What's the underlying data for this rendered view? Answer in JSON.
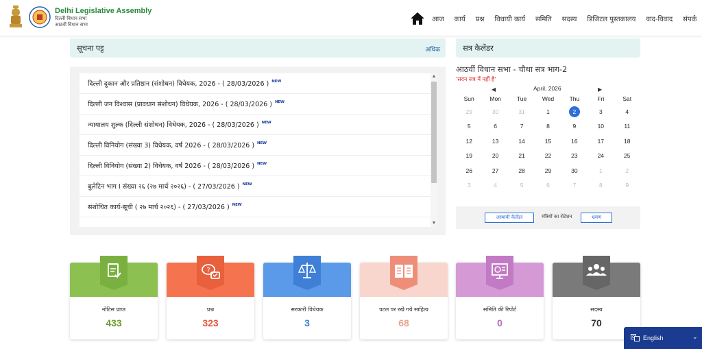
{
  "header": {
    "title": "Delhi Legislative Assembly",
    "subtitle1": "दिल्ली विधान सभा",
    "subtitle2": "आठवीं विधान सभा",
    "nav": [
      "आज",
      "कार्य",
      "प्रश्न",
      "विधायी कार्य",
      "समिति",
      "सदस्य",
      "डिजिटल पुस्तकालय",
      "वाद-विवाद",
      "संपर्क"
    ]
  },
  "notice": {
    "title": "सूचना पट्ट",
    "more": "अधिक",
    "badge": "NEW",
    "items": [
      "दिल्ली दुकान और प्रतिष्ठान (संशोधन) विधेयक, 2026 - ( 28/03/2026 )",
      "दिल्ली जन विश्वास (प्रावधान संशोधन) विधेयक, 2026 - ( 28/03/2026 )",
      "न्यायालय शुल्क (दिल्ली संशोधन) विधेयक, 2026 - ( 28/03/2026 )",
      "दिल्ली विनियोग (संख्या 3) विधेयक, वर्ष 2026 - ( 28/03/2026 )",
      "दिल्ली विनियोग (संख्या 2) विधेयक, वर्ष 2026 - ( 28/03/2026 )",
      "बुलेटिन भाग I संख्या २६ (२७ मार्च २०२६) - ( 27/03/2026 )",
      "संशोधित कार्य-सूची ( २७ मार्च २०२६) - ( 27/03/2026 )"
    ]
  },
  "calendar": {
    "title": "सत्र कैलेंडर",
    "session": "आठवीं विधान सभा - चौथा सत्र भाग-2",
    "status": "'सदन सत्र में नहीं है'",
    "prev": "◀",
    "next": "▶",
    "month": "April, 2026",
    "days": [
      "Sun",
      "Mon",
      "Tue",
      "Wed",
      "Thu",
      "Fri",
      "Sat"
    ],
    "weeks": [
      [
        "29",
        "30",
        "31",
        "1",
        "2",
        "3",
        "4"
      ],
      [
        "5",
        "6",
        "7",
        "8",
        "9",
        "10",
        "11"
      ],
      [
        "12",
        "13",
        "14",
        "15",
        "16",
        "17",
        "18"
      ],
      [
        "19",
        "20",
        "21",
        "22",
        "23",
        "24",
        "25"
      ],
      [
        "26",
        "27",
        "28",
        "29",
        "30",
        "1",
        "2"
      ],
      [
        "3",
        "4",
        "5",
        "6",
        "7",
        "8",
        "9"
      ]
    ],
    "temp_calendar_btn": "अस्थायी कैलेंडर",
    "rotation_label": "मंत्रियों का रोटेशन",
    "view_btn": "भ्रमण"
  },
  "stats": [
    {
      "label": "नोटिस प्राप्त",
      "value": "433",
      "color": "#8cc152",
      "value_color": "#6a9e2d",
      "icon": "notice-icon"
    },
    {
      "label": "प्रश्न",
      "value": "323",
      "color": "#f5734f",
      "value_color": "#e8533c",
      "icon": "question-icon"
    },
    {
      "label": "सरकारी विधेयक",
      "value": "3",
      "color": "#5b9ae8",
      "value_color": "#3f7fd6",
      "icon": "scales-icon"
    },
    {
      "label": "पटल पर रखे गये साहित्य",
      "value": "68",
      "color": "#f8d6cd",
      "value_color": "#e9a38f",
      "icon": "book-icon"
    },
    {
      "label": "समिति की रिपोर्ट",
      "value": "0",
      "color": "#d59ad6",
      "value_color": "#b56bb8",
      "icon": "report-icon"
    },
    {
      "label": "सदस्य",
      "value": "70",
      "color": "#7a7a7a",
      "value_color": "#333333",
      "icon": "members-icon"
    }
  ],
  "language": {
    "label": "English"
  }
}
